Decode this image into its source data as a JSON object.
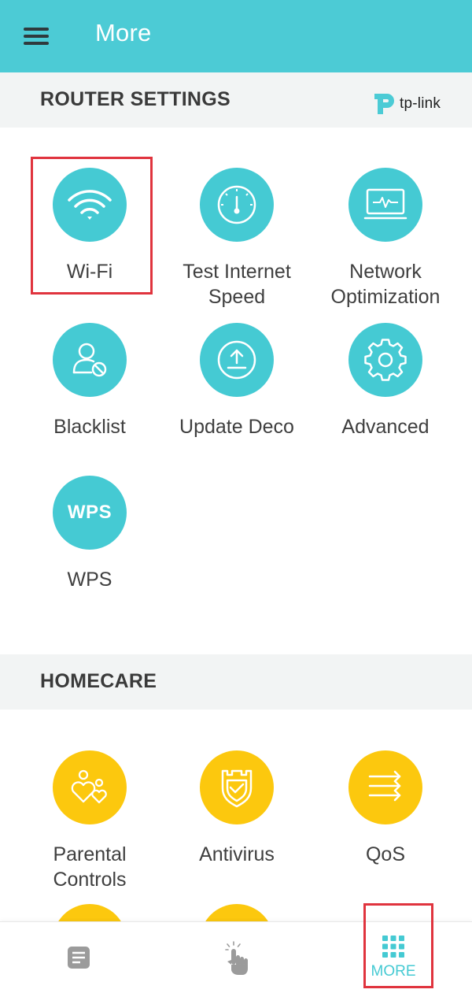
{
  "appbar": {
    "title": "More"
  },
  "router_settings": {
    "header": "ROUTER SETTINGS",
    "logo_text": "tp-link",
    "items": [
      {
        "label": "Wi-Fi",
        "icon": "wifi-icon"
      },
      {
        "label": "Test Internet\nSpeed",
        "icon": "speedometer-icon"
      },
      {
        "label": "Network\nOptimization",
        "icon": "monitor-pulse-icon"
      },
      {
        "label": "Blacklist",
        "icon": "user-blocked-icon"
      },
      {
        "label": "Update Deco",
        "icon": "upload-icon"
      },
      {
        "label": "Advanced",
        "icon": "gear-icon"
      },
      {
        "label": "WPS",
        "icon": "wps-icon",
        "icon_text": "WPS"
      }
    ]
  },
  "homecare": {
    "header": "HOMECARE",
    "items": [
      {
        "label": "Parental\nControls",
        "icon": "family-hearts-icon"
      },
      {
        "label": "Antivirus",
        "icon": "shield-icon"
      },
      {
        "label": "QoS",
        "icon": "arrows-right-icon"
      }
    ]
  },
  "bottom_nav": {
    "items": [
      {
        "label": "",
        "icon": "document-icon"
      },
      {
        "label": "",
        "icon": "touch-hand-icon"
      },
      {
        "label": "MORE",
        "icon": "grid-icon"
      }
    ]
  },
  "colors": {
    "appbar": "#4ccbd5",
    "teal_icon": "#45cad3",
    "yellow_icon": "#fcc80e",
    "highlight": "#e0343e",
    "section_bg": "#f2f4f4"
  }
}
